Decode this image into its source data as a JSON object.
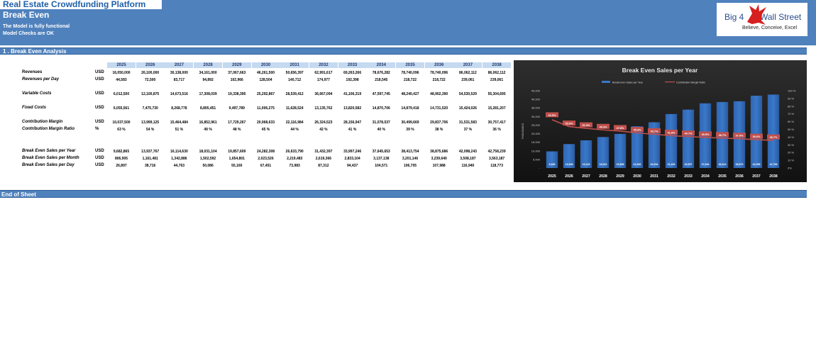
{
  "header": {
    "app_title": "Real Estate Crowdfunding Platform",
    "page_title": "Break Even",
    "status_lines": [
      "The Model is fully functional",
      "Model Checks are OK"
    ]
  },
  "logo": {
    "name_left": "Big 4",
    "name_right": "Wall Street",
    "tagline": "Believe, Conceive, Excel"
  },
  "section": {
    "title": "1 . Break Even Analysis"
  },
  "footer": {
    "label": "End of Sheet"
  },
  "colors": {
    "header_bg": "#4f81bd",
    "year_header_bg": "#c5d9f1",
    "chart_bg": "#1c1c1c",
    "bar": "#3a78c9",
    "line": "#c0504d"
  },
  "table": {
    "years": [
      "2025",
      "2026",
      "2027",
      "2028",
      "2029",
      "2030",
      "2031",
      "2032",
      "2033",
      "2034",
      "2035",
      "2036",
      "2037",
      "2038"
    ],
    "rows": [
      {
        "label": "Revenues",
        "unit": "USD",
        "italic": false,
        "values": [
          "16,050,000",
          "26,100,000",
          "30,138,000",
          "34,161,000",
          "37,067,663",
          "46,261,500",
          "50,656,397",
          "62,991,617",
          "69,263,266",
          "78,676,282",
          "78,740,096",
          "78,740,096",
          "86,062,112",
          "86,062,112"
        ]
      },
      {
        "label": "Revenues per Day",
        "unit": "USD",
        "italic": true,
        "values": [
          "44,583",
          "72,500",
          "83,717",
          "94,892",
          "102,966",
          "128,504",
          "140,712",
          "174,977",
          "192,398",
          "218,545",
          "218,722",
          "218,722",
          "239,061",
          "239,061"
        ]
      },
      {
        "label": "Variable Costs",
        "unit": "USD",
        "italic": true,
        "values": [
          "6,012,500",
          "12,100,875",
          "14,673,516",
          "17,308,039",
          "19,338,395",
          "25,292,867",
          "28,539,412",
          "36,667,094",
          "41,106,319",
          "47,597,745",
          "48,240,427",
          "48,902,390",
          "54,530,529",
          "55,304,695"
        ]
      },
      {
        "label": "Fixed Costs",
        "unit": "USD",
        "italic": true,
        "values": [
          "6,055,561",
          "7,475,730",
          "8,268,778",
          "8,895,451",
          "9,497,789",
          "11,006,275",
          "11,628,524",
          "13,135,762",
          "13,820,582",
          "14,870,706",
          "14,879,418",
          "14,731,520",
          "15,424,026",
          "15,281,207"
        ]
      },
      {
        "label": "Contribution Margin",
        "unit": "USD",
        "italic": true,
        "values": [
          "10,037,500",
          "13,999,125",
          "15,464,484",
          "16,852,961",
          "17,729,267",
          "20,968,633",
          "22,116,984",
          "26,324,523",
          "28,156,947",
          "31,078,537",
          "30,499,669",
          "29,837,706",
          "31,531,583",
          "30,757,417"
        ]
      },
      {
        "label": "Contribution Margin Ratio",
        "unit": "%",
        "italic": true,
        "values": [
          "63 %",
          "54 %",
          "51 %",
          "49 %",
          "48 %",
          "45 %",
          "44 %",
          "42 %",
          "41 %",
          "40 %",
          "39 %",
          "38 %",
          "37 %",
          "36 %"
        ]
      },
      {
        "label": "Break Even Sales per Year",
        "unit": "USD",
        "italic": true,
        "values": [
          "9,682,865",
          "13,937,767",
          "16,114,630",
          "18,031,104",
          "19,857,609",
          "24,282,308",
          "26,633,790",
          "31,432,397",
          "33,997,246",
          "37,645,653",
          "38,413,754",
          "38,875,686",
          "42,098,243",
          "42,758,239"
        ]
      },
      {
        "label": "Break Even Sales per Month",
        "unit": "USD",
        "italic": true,
        "values": [
          "806,905",
          "1,161,481",
          "1,342,886",
          "1,502,592",
          "1,654,801",
          "2,023,526",
          "2,219,483",
          "2,619,366",
          "2,833,104",
          "3,137,138",
          "3,201,146",
          "3,239,640",
          "3,508,187",
          "3,563,187"
        ]
      },
      {
        "label": "Break Even Sales per Day",
        "unit": "USD",
        "italic": true,
        "values": [
          "26,897",
          "38,716",
          "44,763",
          "50,086",
          "55,160",
          "67,451",
          "73,983",
          "87,312",
          "94,437",
          "104,571",
          "106,705",
          "107,988",
          "116,940",
          "118,773"
        ]
      }
    ]
  },
  "chart_data": {
    "type": "bar",
    "title": "Break Even Sales per Year",
    "categories": [
      "2025",
      "2026",
      "2027",
      "2028",
      "2029",
      "2030",
      "2031",
      "2032",
      "2033",
      "2034",
      "2035",
      "2036",
      "2037",
      "2038"
    ],
    "series": [
      {
        "name": "Break Even Sales per Year",
        "type": "bar",
        "axis": "left",
        "values": [
          9683,
          13938,
          16115,
          18031,
          19858,
          24282,
          26634,
          31432,
          33997,
          37646,
          38414,
          38876,
          42098,
          42758
        ]
      },
      {
        "name": "Contribution Margin Ratio",
        "type": "line",
        "axis": "right",
        "values": [
          62.5,
          53.6,
          51.3,
          49.3,
          47.8,
          45.3,
          43.7,
          41.8,
          40.7,
          39.5,
          38.7,
          37.9,
          36.6,
          35.7
        ]
      }
    ],
    "bar_labels": [
      "9,683",
      "13,938",
      "16,115",
      "18,031",
      "19,858",
      "24,282",
      "26,634",
      "31,432",
      "33,997",
      "37,646",
      "38,414",
      "38,876",
      "42,098",
      "42,758"
    ],
    "line_labels": [
      "62.5%",
      "53.6%",
      "51.3%",
      "49.3%",
      "47.8%",
      "45.3%",
      "43.7%",
      "41.8%",
      "40.7%",
      "39.5%",
      "38.7%",
      "37.9%",
      "36.6%",
      "35.7%"
    ],
    "ylabel": "THOUSANDS",
    "ylim": [
      0,
      45000
    ],
    "y_ticks": [
      "-",
      "5,000",
      "10,000",
      "15,000",
      "20,000",
      "25,000",
      "30,000",
      "35,000",
      "40,000",
      "45,000"
    ],
    "y2lim": [
      0,
      100
    ],
    "y2_ticks": [
      "0%",
      "10 %",
      "20 %",
      "30 %",
      "40 %",
      "50 %",
      "60 %",
      "70 %",
      "80 %",
      "90 %",
      "100 %"
    ],
    "legend": "top"
  }
}
